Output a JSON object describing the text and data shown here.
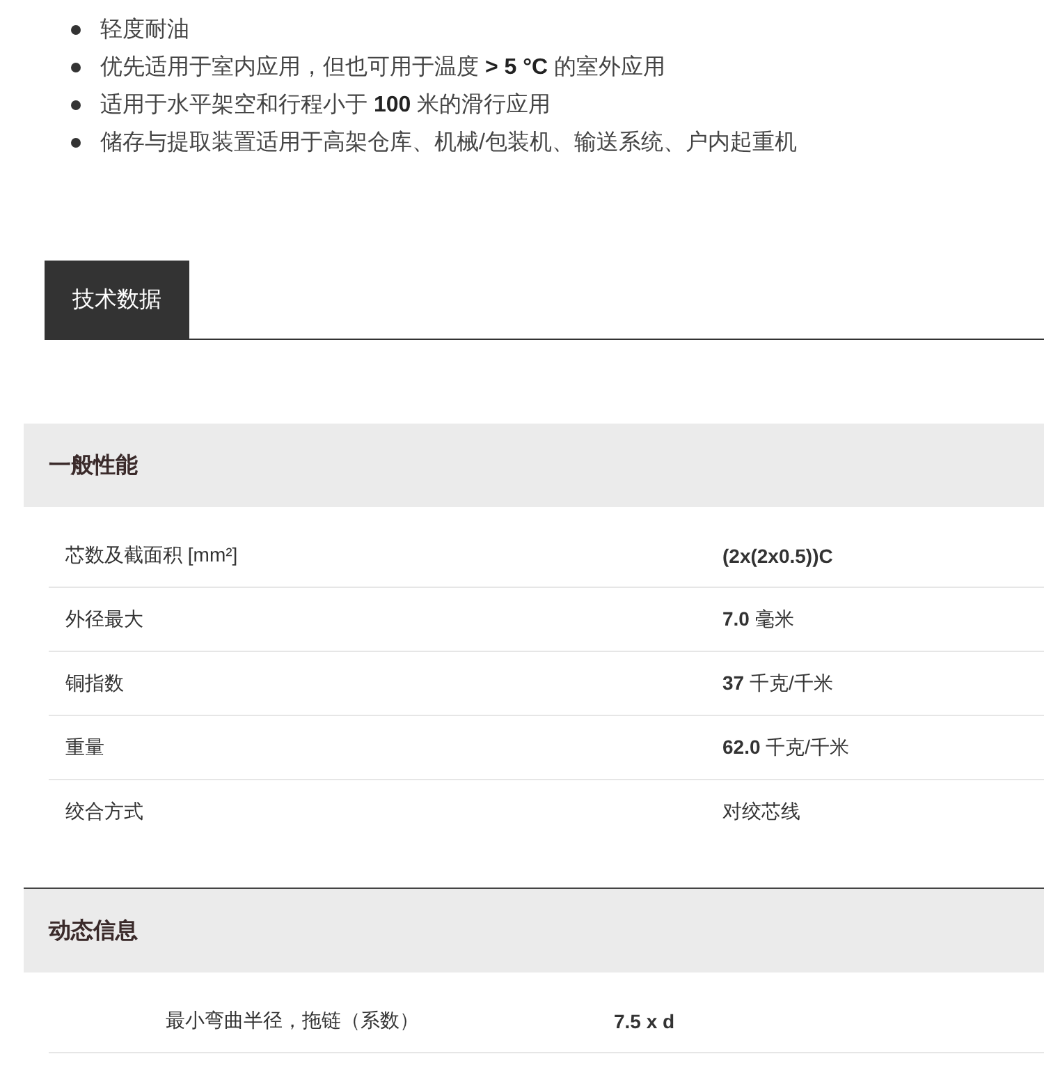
{
  "features": [
    "轻度耐油",
    "优先适用于室内应用，但也可用于温度 **> 5 °C** 的室外应用",
    "适用于水平架空和行程小于 **100** 米的滑行应用",
    "储存与提取装置适用于高架仓库、机械/包装机、输送系统、户内起重机"
  ],
  "tabs": [
    {
      "label": "技术数据",
      "selected": true
    }
  ],
  "sections": [
    {
      "title": "一般性能",
      "kind": "wide",
      "rows": [
        {
          "label": "芯数及截面积 [mm²]",
          "value": "**(2x(2x0.5))C**"
        },
        {
          "label": "外径最大",
          "value": "**7.0** 毫米"
        },
        {
          "label": "铜指数",
          "value": "**37** 千克/千米"
        },
        {
          "label": "重量",
          "value": "**62.0** 千克/千米"
        },
        {
          "label": "绞合方式",
          "value": "对绞芯线"
        }
      ]
    },
    {
      "title": "动态信息",
      "kind": "narrow",
      "rows": [
        {
          "label": "最小弯曲半径，拖链（系数）",
          "value": "**7.5 x d**"
        }
      ]
    }
  ]
}
